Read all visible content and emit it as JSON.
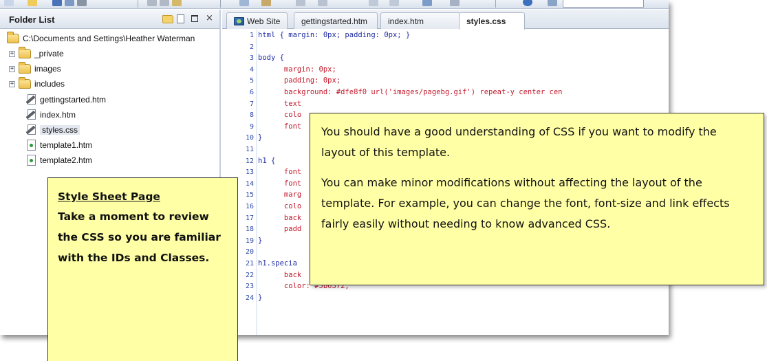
{
  "folder_list": {
    "title": "Folder List",
    "items": [
      {
        "label": "C:\\Documents and Settings\\Heather Waterman",
        "icon": "folder-icon",
        "expander": ""
      },
      {
        "label": "_private",
        "icon": "folder-icon",
        "expander": "+"
      },
      {
        "label": "images",
        "icon": "folder-icon",
        "expander": "+"
      },
      {
        "label": "includes",
        "icon": "folder-icon",
        "expander": "+"
      },
      {
        "label": "gettingstarted.htm",
        "icon": "html-file-icon",
        "expander": ""
      },
      {
        "label": "index.htm",
        "icon": "html-file-icon",
        "expander": ""
      },
      {
        "label": "styles.css",
        "icon": "css-file-icon",
        "expander": ""
      },
      {
        "label": "template1.htm",
        "icon": "template-file-icon",
        "expander": ""
      },
      {
        "label": "template2.htm",
        "icon": "template-file-icon",
        "expander": ""
      }
    ],
    "selected": "styles.css"
  },
  "tabs": [
    {
      "label": "Web Site",
      "icon": "web-site-icon"
    },
    {
      "label": "gettingstarted.htm"
    },
    {
      "label": "index.htm"
    },
    {
      "label": "styles.css",
      "active": true
    }
  ],
  "code_lines": [
    {
      "n": "1",
      "text": "html { margin: 0px; padding: 0px; }"
    },
    {
      "n": "2",
      "text": ""
    },
    {
      "n": "3",
      "text": "body {"
    },
    {
      "n": "4",
      "text": "      margin: 0px;"
    },
    {
      "n": "5",
      "text": "      padding: 0px;"
    },
    {
      "n": "6",
      "text": "      background: #dfe8f0 url('images/pagebg.gif') repeat-y center cen"
    },
    {
      "n": "7",
      "text": "      text"
    },
    {
      "n": "8",
      "text": "      colo"
    },
    {
      "n": "9",
      "text": "      font"
    },
    {
      "n": "10",
      "text": "}"
    },
    {
      "n": "11",
      "text": ""
    },
    {
      "n": "12",
      "text": "h1 {"
    },
    {
      "n": "13",
      "text": "      font"
    },
    {
      "n": "14",
      "text": "      font"
    },
    {
      "n": "15",
      "text": "      marg"
    },
    {
      "n": "16",
      "text": "      colo"
    },
    {
      "n": "17",
      "text": "      back"
    },
    {
      "n": "18",
      "text": "      padd"
    },
    {
      "n": "19",
      "text": "}"
    },
    {
      "n": "20",
      "text": ""
    },
    {
      "n": "21",
      "text": "h1.specia"
    },
    {
      "n": "22",
      "text": "      back"
    },
    {
      "n": "23",
      "text": "      color: #5b6372;"
    },
    {
      "n": "24",
      "text": "}"
    }
  ],
  "callout_left": {
    "heading": "Style Sheet Page",
    "body": "Take a moment to review the CSS so you are familiar with the IDs and Classes."
  },
  "callout_right": {
    "para1": "You should have a good understanding of CSS if you want to modify the layout of this template.",
    "para2": "You can make minor modifications without affecting the layout of the template.  For example, you can change the font, font-size and link effects fairly easily without needing to know advanced CSS."
  },
  "colors": {
    "callout_fill": "#ffffa6",
    "line_number": "#2a48a8",
    "code_selector": "#1e2aa0",
    "code_property": "#c41a2b"
  }
}
